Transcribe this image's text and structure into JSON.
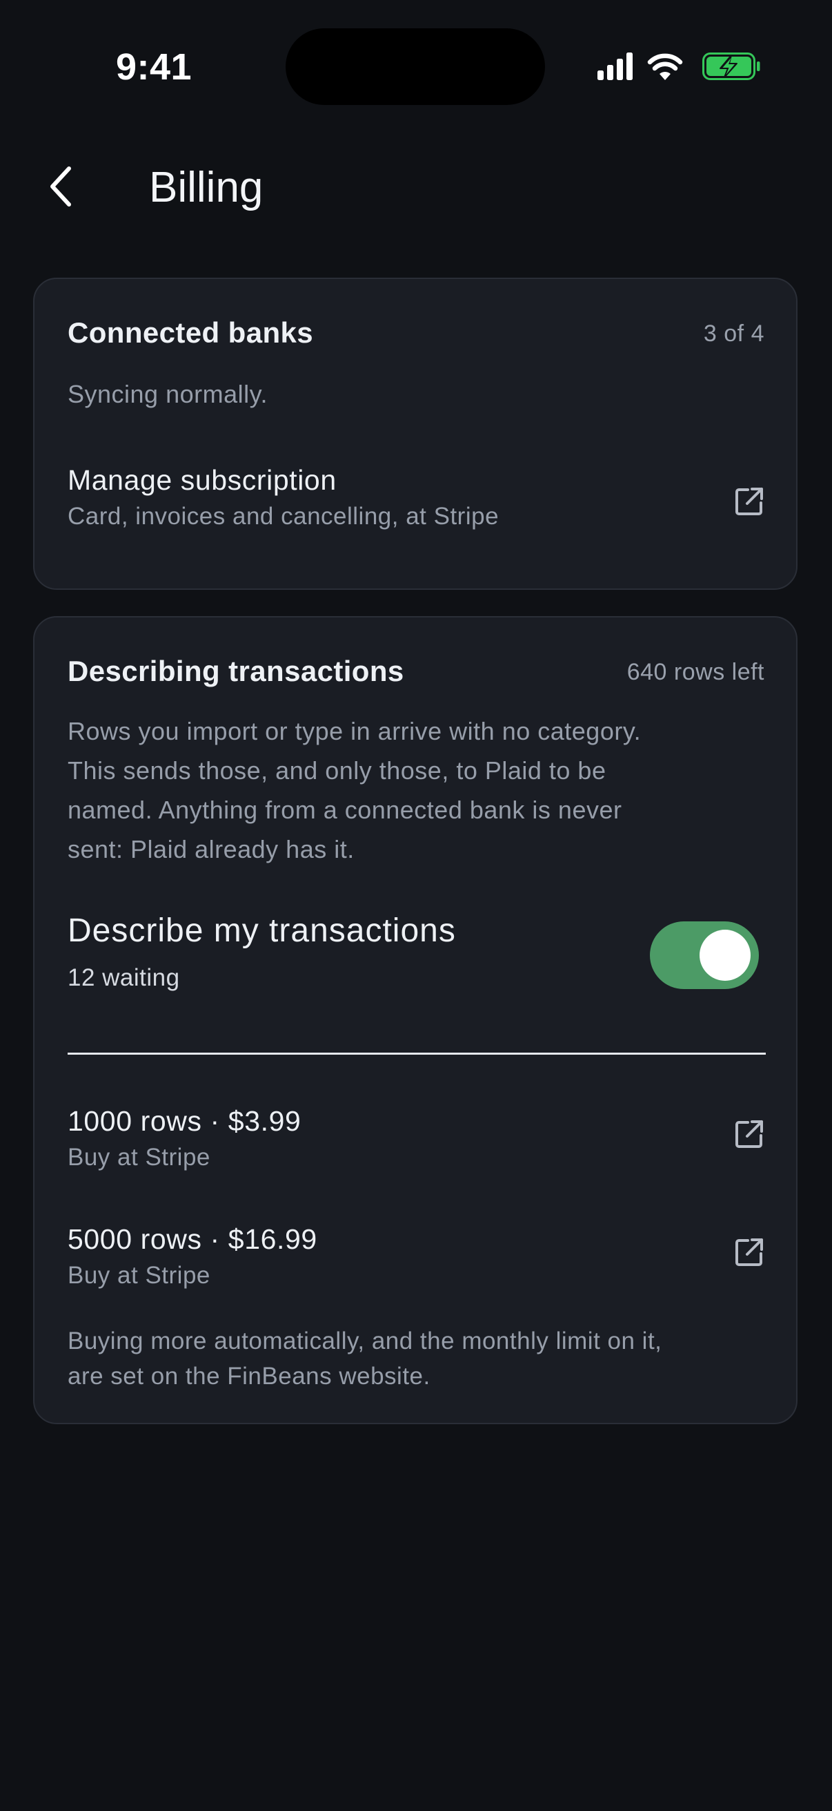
{
  "status_bar": {
    "time": "9:41",
    "icons": [
      "signal-icon",
      "wifi-icon",
      "battery-charging-icon"
    ],
    "battery_color": "#35c759"
  },
  "header": {
    "title": "Billing",
    "back_icon": "chevron-left-icon"
  },
  "connected_banks": {
    "title": "Connected banks",
    "count": "3 of 4",
    "status": "Syncing normally.",
    "manage": {
      "title": "Manage subscription",
      "subtitle": "Card, invoices and cancelling, at Stripe",
      "icon": "external-link-icon"
    }
  },
  "describing": {
    "title": "Describing transactions",
    "rows_left": "640 rows left",
    "description_lines": [
      "Rows you import or type in arrive with no category.",
      "This sends those, and only those, to Plaid to be",
      "named. Anything from a connected bank is never",
      "sent: Plaid already has it."
    ],
    "toggle": {
      "title": "Describe my transactions",
      "subtitle": "12 waiting",
      "on": true,
      "color": "#4c9b66"
    },
    "packs": [
      {
        "title": "1000 rows · $3.99",
        "subtitle": "Buy at Stripe",
        "icon": "external-link-icon"
      },
      {
        "title": "5000 rows · $16.99",
        "subtitle": "Buy at Stripe",
        "icon": "external-link-icon"
      }
    ],
    "footnote_lines": [
      "Buying more automatically, and the monthly limit on it,",
      "are set on the FinBeans website."
    ]
  }
}
